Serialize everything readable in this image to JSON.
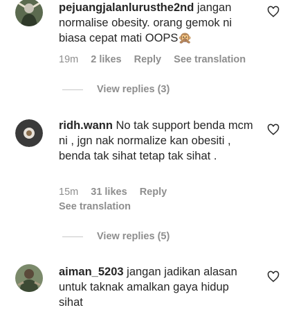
{
  "comments": [
    {
      "username": "pejuangjalanlurusthe2nd",
      "text": " jangan normalise obesity. orang gemok ni biasa cepat mati OOPS",
      "emoji": "🙊",
      "time": "19m",
      "likes": "2 likes",
      "reply": "Reply",
      "see_translation": "See translation",
      "view_replies": "View replies (3)"
    },
    {
      "username": "ridh.wann",
      "text": " No tak support benda mcm ni , jgn nak normalize kan obesiti , benda tak sihat tetap tak sihat .",
      "time": "15m",
      "likes": "31 likes",
      "reply": "Reply",
      "see_translation": "See translation",
      "view_replies": "View replies (5)"
    },
    {
      "username": "aiman_5203",
      "text": " jangan jadikan alasan untuk taknak amalkan gaya hidup sihat"
    }
  ],
  "colors": {
    "text": "#262626",
    "muted": "#8e8e8e",
    "divider": "#c7c7c7"
  },
  "icons": {
    "like": "heart-outline-icon"
  }
}
